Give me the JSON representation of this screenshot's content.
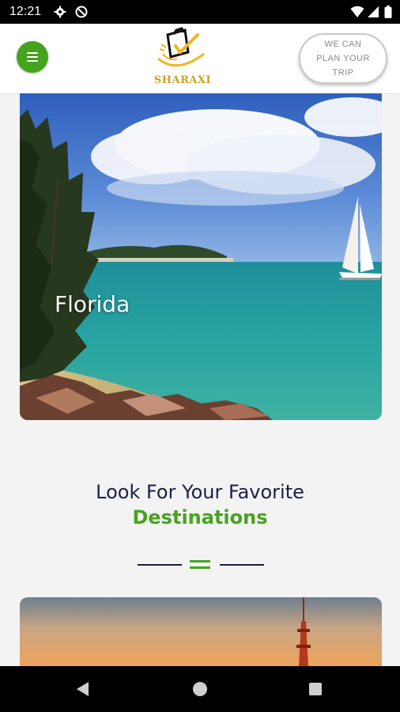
{
  "status_bar": {
    "time": "12:21",
    "left_icons": [
      "gear-icon",
      "no-sim-icon"
    ],
    "right_icons": [
      "wifi-icon",
      "signal-icon",
      "battery-icon"
    ]
  },
  "header": {
    "menu_icon": "hamburger-icon",
    "logo_text": "SHARAXI",
    "plan_button_label": "WE CAN PLAN YOUR TRIP"
  },
  "hero": {
    "title": "Florida"
  },
  "section": {
    "title": "Look For Your Favorite",
    "subtitle": "Destinations"
  },
  "nav_bar": {
    "icons": [
      "back-icon",
      "home-icon",
      "recents-icon"
    ]
  },
  "colors": {
    "accent_green": "#46a31e",
    "title_navy": "#1c1f46",
    "logo_gold": "#c9a227"
  }
}
